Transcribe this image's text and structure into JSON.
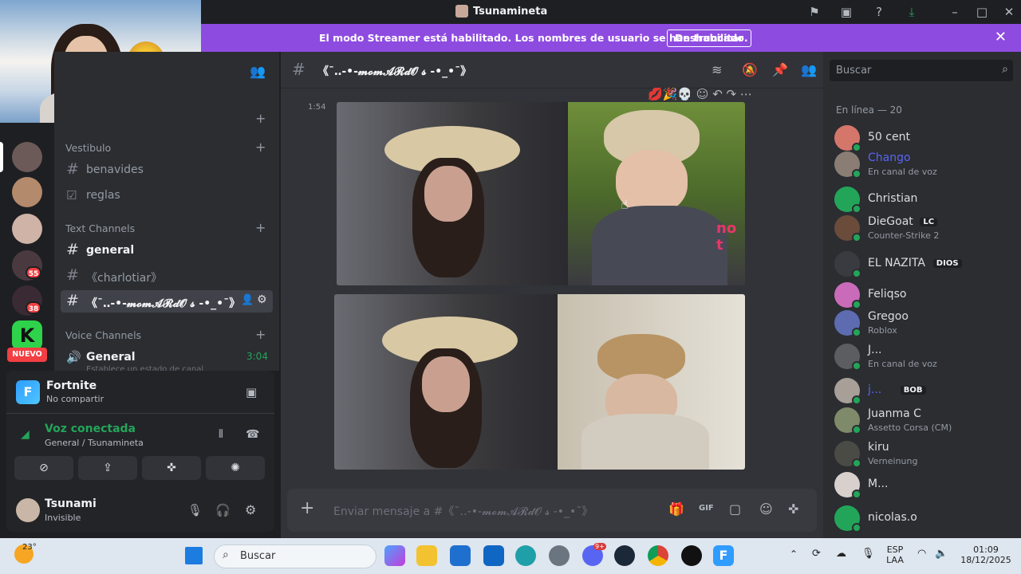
{
  "window": {
    "title": "Tsunamineta"
  },
  "banner": {
    "message": "El modo Streamer está habilitado. Los nombres de usuario se han truncado.",
    "button": "Deshabilitar"
  },
  "servers": {
    "badges": [
      "55",
      "38"
    ],
    "new_label": "NUEVO"
  },
  "sidebar": {
    "categories": {
      "vestibulo": "Vestibulo",
      "text": "Text Channels",
      "voice": "Voice Channels"
    },
    "channels": {
      "benavides": "benavides",
      "reglas": "reglas",
      "general": "general",
      "charlotiar": "《charlotiar》",
      "momardos": "《¯‥-•-𝓶𝓸𝓶𝓐𝓡𝓭𝓞 𝓼 -•_•¯》"
    },
    "voice_channel": {
      "name": "General",
      "time": "3:04",
      "status": "Establece un estado de canal"
    }
  },
  "panel": {
    "activity": {
      "title": "Fortnite",
      "sub": "No compartir",
      "icon_letter": "F"
    },
    "voice": {
      "title": "Voz conectada",
      "sub": "General / Tsunamineta"
    },
    "user": {
      "name": "Tsunami",
      "status": "Invisible"
    }
  },
  "chat": {
    "channel_name": "《¯‥-•-𝓶𝓸𝓶𝓐𝓡𝓭𝓞 𝓼 -•_•¯》",
    "timestamp": "1:54",
    "video_caption": "no t",
    "composer_placeholder": "Enviar mensaje a #《¯‥-•-𝓶𝓸𝓶𝓐𝓡𝓭𝓞 𝓼 -•_•¯》"
  },
  "members": {
    "search_placeholder": "Buscar",
    "online_header": "En línea — 20",
    "list": [
      {
        "name": "50 cent",
        "status": "",
        "tag": "",
        "color": "#d4766a",
        "name_color": "#dbdee1"
      },
      {
        "name": "Chango",
        "status": "En canal de voz",
        "tag": "",
        "color": "#8a7d73",
        "name_color": "#5865f2"
      },
      {
        "name": "Christian",
        "status": "",
        "tag": "",
        "color": "#23a559",
        "name_color": "#dbdee1"
      },
      {
        "name": "DieGoat",
        "status": "Counter-Strike 2",
        "tag": "LC",
        "color": "#6b4b3a",
        "name_color": "#dbdee1"
      },
      {
        "name": "EL NAZITA",
        "status": "",
        "tag": "DIOS",
        "color": "#3a3b40",
        "name_color": "#dbdee1"
      },
      {
        "name": "Feliqso",
        "status": "",
        "tag": "",
        "color": "#c96bb8",
        "name_color": "#dbdee1"
      },
      {
        "name": "Gregoo",
        "status": "Roblox",
        "tag": "",
        "color": "#5d6bb0",
        "name_color": "#dbdee1"
      },
      {
        "name": "J...",
        "status": "En canal de voz",
        "tag": "",
        "color": "#5b5d60",
        "name_color": "#dbdee1"
      },
      {
        "name": "j...",
        "status": "",
        "tag": "BOB",
        "color": "#a79f98",
        "name_color": "#5865f2"
      },
      {
        "name": "Juanma C",
        "status": "Assetto Corsa (CM)",
        "tag": "",
        "color": "#7e8a6a",
        "name_color": "#dbdee1"
      },
      {
        "name": "kiru",
        "status": "Verneinung",
        "tag": "",
        "color": "#4a4b45",
        "name_color": "#dbdee1"
      },
      {
        "name": "M...",
        "status": "",
        "tag": "",
        "color": "#d7d0cc",
        "name_color": "#dbdee1"
      },
      {
        "name": "nicolas.o",
        "status": "",
        "tag": "",
        "color": "#23a559",
        "name_color": "#dbdee1"
      }
    ]
  },
  "taskbar": {
    "weather": "23°",
    "search": "Buscar",
    "lang1": "ESP",
    "lang2": "LAA",
    "time": "01:09",
    "date": "18/12/2025",
    "discord_badge": "9+"
  }
}
